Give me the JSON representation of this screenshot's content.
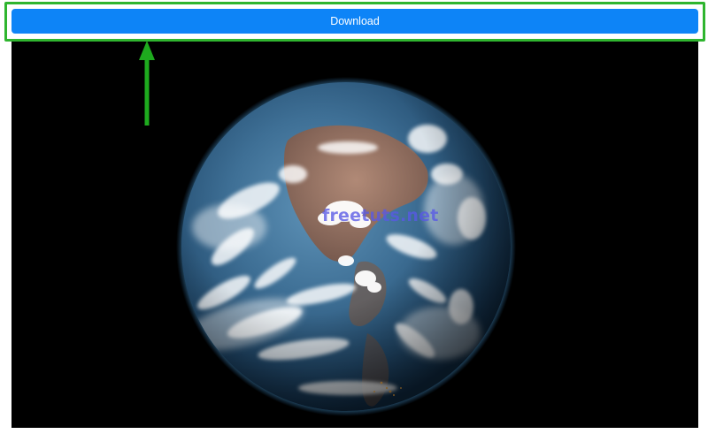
{
  "download_button": {
    "label": "Download"
  },
  "image": {
    "subject": "earth-globe",
    "watermark": "freetuts.net"
  },
  "colors": {
    "button_background": "#0d84f7",
    "button_text": "#ffffff",
    "highlight_frame": "#2fb52f",
    "arrow": "#1eaa1e",
    "image_background": "#000000",
    "watermark": "#5858e6"
  },
  "annotations": {
    "arrow_target": "download_button"
  }
}
